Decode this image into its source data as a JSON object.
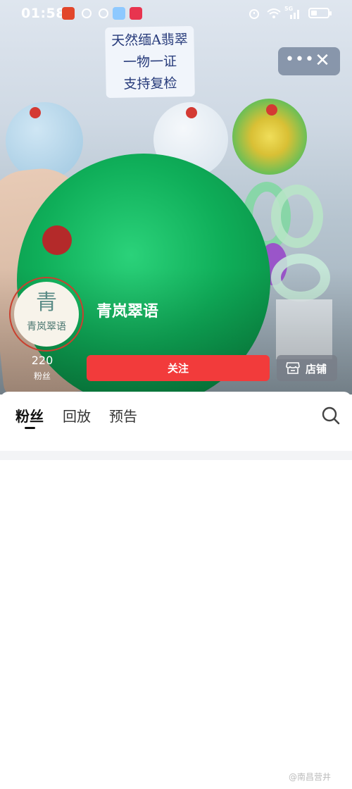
{
  "status_bar": {
    "time": "01:58",
    "network": "5G",
    "icons": [
      "app-badge-icon",
      "circle-icon",
      "cloud-icon",
      "weather-icon",
      "video-icon",
      "alarm-icon",
      "wifi-icon",
      "signal-icon",
      "battery-icon"
    ]
  },
  "background_sign": [
    "天然缅A翡翠",
    "一物一证",
    "支持复检"
  ],
  "capsule": {
    "more_label": "•••",
    "close_label": "✕"
  },
  "shop": {
    "avatar_mark": "青",
    "avatar_text": "青岚翠语",
    "name": "青岚翠语",
    "fans_count": "220",
    "fans_label": "粉丝",
    "follow_label": "关注",
    "store_label": "店铺"
  },
  "tabs": [
    {
      "label": "粉丝",
      "active": true
    },
    {
      "label": "回放",
      "active": false
    },
    {
      "label": "预告",
      "active": false
    }
  ],
  "watermark": "@南昌营井",
  "colors": {
    "follow_red": "#f23b3b",
    "accent_green": "#0fae59"
  }
}
